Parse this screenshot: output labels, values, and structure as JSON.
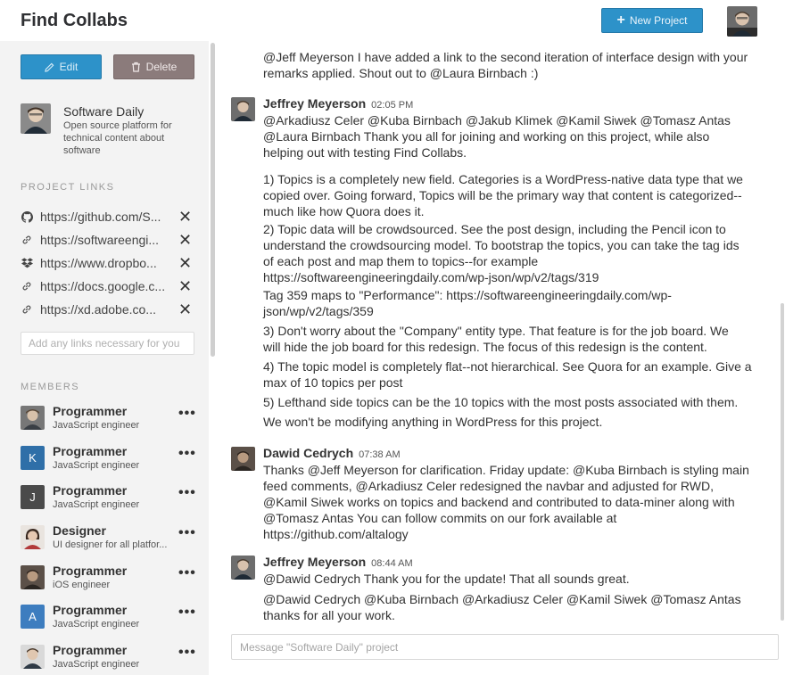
{
  "header": {
    "title": "Find Collabs",
    "new_project_label": "New Project",
    "user_avatar_icon": "user-photo-icon"
  },
  "sidebar": {
    "edit_label": "Edit",
    "delete_label": "Delete",
    "project": {
      "name": "Software Daily",
      "description": "Open source platform for technical content about software"
    },
    "links_heading": "PROJECT LINKS",
    "links": [
      {
        "icon": "github-icon",
        "url": "https://github.com/S..."
      },
      {
        "icon": "link-icon",
        "url": "https://softwareengi..."
      },
      {
        "icon": "dropbox-icon",
        "url": "https://www.dropbo..."
      },
      {
        "icon": "link-icon",
        "url": "https://docs.google.c..."
      },
      {
        "icon": "link-icon",
        "url": "https://xd.adobe.co..."
      }
    ],
    "link_input_placeholder": "Add any links necessary for you",
    "members_heading": "MEMBERS",
    "members": [
      {
        "avatar": "photo",
        "initial": "",
        "role": "Programmer",
        "desc": "JavaScript engineer"
      },
      {
        "avatar": "letter",
        "initial": "K",
        "role": "Programmer",
        "desc": "JavaScript engineer"
      },
      {
        "avatar": "letter",
        "initial": "J",
        "role": "Programmer",
        "desc": "JavaScript engineer"
      },
      {
        "avatar": "photo",
        "initial": "",
        "role": "Designer",
        "desc": "UI designer for all platfor..."
      },
      {
        "avatar": "photo",
        "initial": "",
        "role": "Programmer",
        "desc": "iOS engineer"
      },
      {
        "avatar": "letter",
        "initial": "A",
        "role": "Programmer",
        "desc": "JavaScript engineer"
      },
      {
        "avatar": "photo",
        "initial": "",
        "role": "Programmer",
        "desc": "JavaScript engineer"
      }
    ]
  },
  "chat": {
    "lead_message": [
      "@Jeff Meyerson I have added a link to the second iteration of interface design with your",
      "remarks applied. Shout out to @Laura Birnbach :)"
    ],
    "messages": [
      {
        "author": "Jeffrey Meyerson",
        "time": "02:05 PM",
        "paragraphs": [
          [
            "@Arkadiusz Celer @Kuba Birnbach @Jakub Klimek @Kamil Siwek @Tomasz Antas",
            "@Laura Birnbach Thank you all for joining and working on this project, while also",
            "helping out with testing Find Collabs."
          ],
          [
            "1) Topics is a completely new field. Categories is a WordPress-native data type that we",
            "copied over. Going forward, Topics will be the primary way that content is categorized--",
            "much like how Quora does it."
          ],
          [
            "2) Topic data will be crowdsourced. See the post design, including the Pencil icon to",
            "understand the crowdsourcing model. To bootstrap the topics, you can take the tag ids",
            "of each post and map them to topics--for example",
            "https://softwareengineeringdaily.com/wp-json/wp/v2/tags/319"
          ],
          [
            "Tag 359 maps to \"Performance\": https://softwareengineeringdaily.com/wp-",
            "json/wp/v2/tags/359"
          ],
          [
            "3) Don't worry about the \"Company\" entity type. That feature is for the job board. We",
            "will hide the job board for this redesign. The focus of this redesign is the content."
          ],
          [
            "4) The topic model is completely flat--not hierarchical. See Quora for an example. Give a",
            "max of 10 topics per post"
          ],
          [
            "5) Lefthand side topics can be the 10 topics with the most posts associated with them."
          ],
          [
            "We won't be modifying anything in WordPress for this project."
          ]
        ]
      },
      {
        "author": "Dawid Cedrych",
        "time": "07:38 AM",
        "paragraphs": [
          [
            "Thanks @Jeff Meyerson for clarification. Friday update: @Kuba Birnbach is styling main",
            "feed comments, @Arkadiusz Celer redesigned the navbar and adjusted for RWD,",
            "@Kamil Siwek works on topics and backend and contributed to data-miner along with",
            "@Tomasz Antas You can follow commits on our fork available at",
            "https://github.com/altalogy"
          ]
        ]
      },
      {
        "author": "Jeffrey Meyerson",
        "time": "08:44 AM",
        "paragraphs": [
          [
            "@Dawid Cedrych Thank you for the update! That all sounds great."
          ],
          [
            "@Dawid Cedrych @Kuba Birnbach @Arkadiusz Celer @Kamil Siwek @Tomasz Antas",
            "thanks for all your work."
          ]
        ]
      }
    ],
    "composer_placeholder": "Message \"Software Daily\" project"
  }
}
